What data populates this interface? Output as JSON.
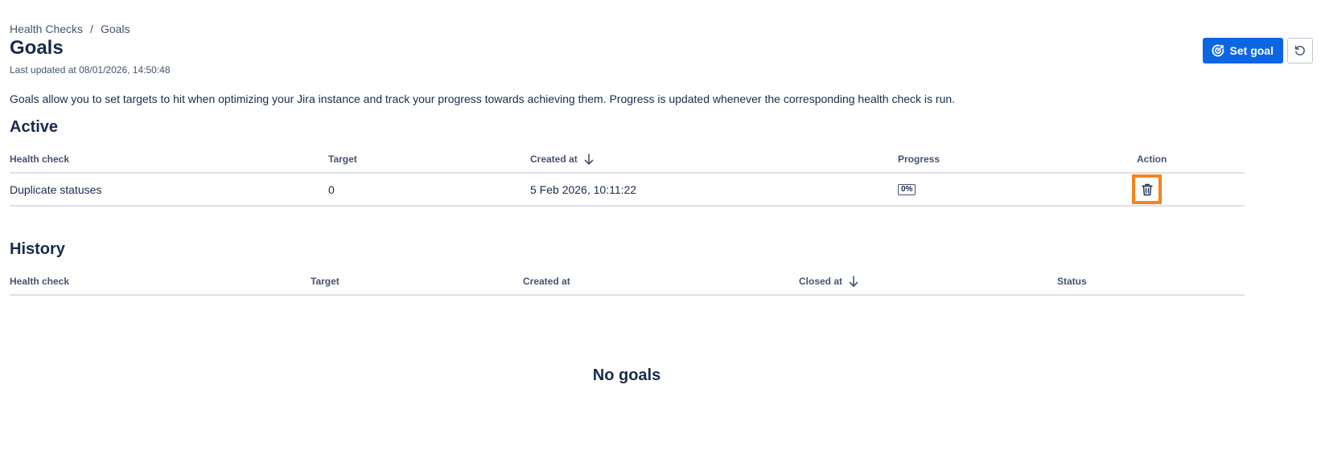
{
  "breadcrumb": {
    "items": [
      "Health Checks",
      "Goals"
    ],
    "separator": "/"
  },
  "page": {
    "title": "Goals",
    "last_updated": "Last updated at 08/01/2026, 14:50:48",
    "description": "Goals allow you to set targets to hit when optimizing your Jira instance and track your progress towards achieving them. Progress is updated whenever the corresponding health check is run."
  },
  "actions": {
    "set_goal_label": "Set goal",
    "set_goal_icon": "target-icon",
    "refresh_icon": "refresh-icon"
  },
  "active": {
    "title": "Active",
    "columns": [
      "Health check",
      "Target",
      "Created at",
      "Progress",
      "Action"
    ],
    "sorted_column": "Created at",
    "rows": [
      {
        "health_check": "Duplicate statuses",
        "target": "0",
        "created_at": "5 Feb 2026, 10:11:22",
        "progress": "0%",
        "action_icon": "trash-icon"
      }
    ]
  },
  "history": {
    "title": "History",
    "columns": [
      "Health check",
      "Target",
      "Created at",
      "Closed at",
      "Status"
    ],
    "sorted_column": "Closed at",
    "empty_text": "No goals"
  },
  "colors": {
    "primary": "#0c66e4",
    "highlight": "#f5841f",
    "text": "#172b4d",
    "subtle_text": "#44546f",
    "border": "#dfe1e6"
  }
}
